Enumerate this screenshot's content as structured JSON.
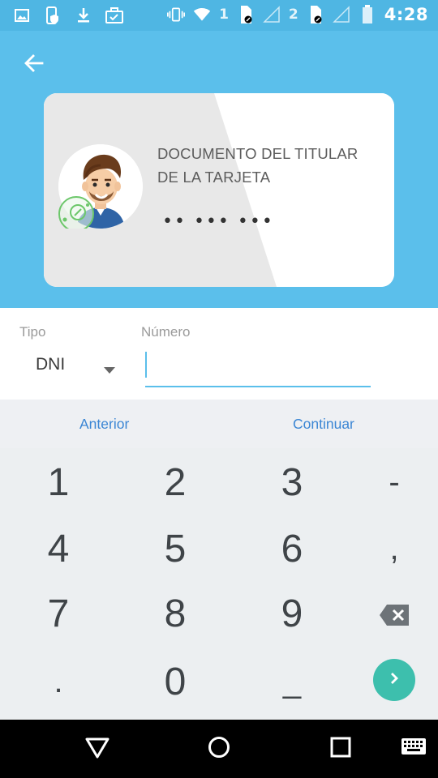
{
  "status_bar": {
    "sim1_label": "1",
    "sim2_label": "2",
    "time": "4:28",
    "icons": [
      "gallery-icon",
      "phone-shield-icon",
      "download-icon",
      "briefcase-check-icon",
      "vibrate-icon",
      "wifi-icon",
      "signal-icon",
      "battery-icon"
    ]
  },
  "header": {
    "back_icon": "arrow-left-icon",
    "card": {
      "title": "DOCUMENTO DEL TITULAR DE LA TARJETA",
      "masked_number": "•• ••• •••",
      "avatar_icon": "cardholder-avatar-icon"
    }
  },
  "form": {
    "tipo_label": "Tipo",
    "tipo_value": "DNI",
    "numero_label": "Número",
    "numero_value": ""
  },
  "keyboard_bar": {
    "prev_label": "Anterior",
    "next_label": "Continuar"
  },
  "keypad": {
    "keys": [
      "1",
      "2",
      "3",
      "-",
      "4",
      "5",
      "6",
      ",",
      "7",
      "8",
      "9",
      ".",
      "0",
      "_"
    ],
    "delete_icon": "backspace-icon",
    "go_icon": "chevron-right-icon"
  },
  "nav_bar": {
    "icons": [
      "back-triangle-icon",
      "home-circle-icon",
      "recents-square-icon",
      "keyboard-icon"
    ]
  },
  "colors": {
    "header_bg": "#5bbfeb",
    "status_bg": "#4fb6e3",
    "accent": "#5bbfeb",
    "link": "#3b86d4",
    "go_button": "#3dbfad"
  }
}
